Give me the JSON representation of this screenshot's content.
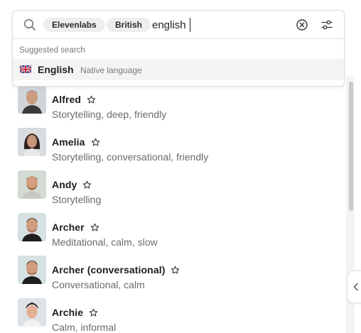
{
  "search": {
    "value": "english",
    "chips": [
      "Elevenlabs",
      "British"
    ],
    "suggest_heading": "Suggested search",
    "suggestion": {
      "language": "English",
      "meta": "Native language",
      "flag_icon": "uk-flag-icon"
    }
  },
  "voices": [
    {
      "name": "Alfred",
      "desc": "Storytelling, deep, friendly"
    },
    {
      "name": "Amelia",
      "desc": "Storytelling, conversational, friendly"
    },
    {
      "name": "Andy",
      "desc": "Storytelling"
    },
    {
      "name": "Archer",
      "desc": "Meditational, calm, slow"
    },
    {
      "name": "Archer (conversational)",
      "desc": "Conversational, calm"
    },
    {
      "name": "Archie",
      "desc": "Calm, informal"
    }
  ],
  "colors": {
    "accent_text": "#1c1c1c",
    "muted_text": "#6b6b6b",
    "chip_bg": "#eeeeee",
    "suggest_bg": "#f4f4f4"
  }
}
